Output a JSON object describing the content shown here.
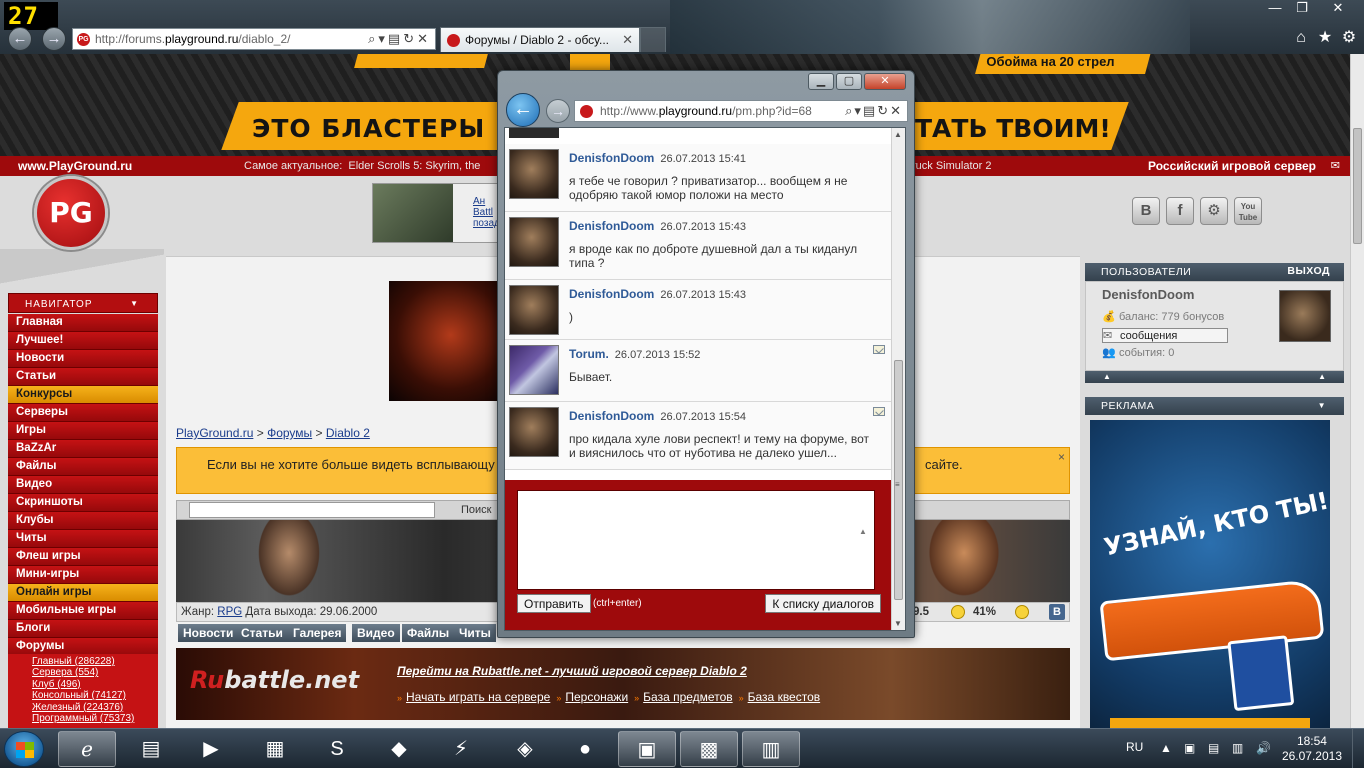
{
  "overlay": {
    "fps": "27"
  },
  "browser": {
    "url_prefix": "http://forums.",
    "url_domain": "playground.ru",
    "url_suffix": "/diablo_2/",
    "tab_title": "Форумы / Diablo 2 - обсу..."
  },
  "banner": {
    "headline_left": "ЭТО БЛАСТЕРЫ N",
    "headline_right": "ТАТЬ ТВОИМ!",
    "top_ad": "Обойма на 20 стрел"
  },
  "redbar": {
    "site": "www.PlayGround.ru",
    "hot_label": "Самое актуальное:",
    "hot_item": "Elder Scrolls 5: Skyrim, the",
    "hot_item2": "ruck Simulator 2",
    "server": "Российский игровой сервер"
  },
  "logo": {
    "text": "PG"
  },
  "adbox": {
    "text": "Ан\nBattl\nпозад"
  },
  "social": [
    {
      "name": "vk",
      "label": "B"
    },
    {
      "name": "facebook",
      "label": "f"
    },
    {
      "name": "steam",
      "label": "⚙"
    },
    {
      "name": "youtube",
      "label": "You\nTube"
    }
  ],
  "nav": {
    "header": "НАВИГАТОР",
    "items": [
      {
        "label": "Главная",
        "highlight": false
      },
      {
        "label": "Лучшее!",
        "highlight": false
      },
      {
        "label": "Новости",
        "highlight": false
      },
      {
        "label": "Статьи",
        "highlight": false
      },
      {
        "label": "Конкурсы",
        "highlight": true
      },
      {
        "label": "Серверы",
        "highlight": false
      },
      {
        "label": "Игры",
        "highlight": false
      },
      {
        "label": "BaZzAr",
        "highlight": false
      },
      {
        "label": "Файлы",
        "highlight": false
      },
      {
        "label": "Видео",
        "highlight": false
      },
      {
        "label": "Скриншоты",
        "highlight": false
      },
      {
        "label": "Клубы",
        "highlight": false
      },
      {
        "label": "Читы",
        "highlight": false
      },
      {
        "label": "Флеш игры",
        "highlight": false
      },
      {
        "label": "Мини-игры",
        "highlight": false
      },
      {
        "label": "Онлайн игры",
        "highlight": true
      },
      {
        "label": "Мобильные игры",
        "highlight": false
      },
      {
        "label": "Блоги",
        "highlight": false
      },
      {
        "label": "Форумы",
        "highlight": false
      }
    ],
    "subforums": [
      "Главный (286228)",
      "Сервера (554)",
      "Клуб (496)",
      "Консольный (74127)",
      "Железный (224376)",
      "Программный (75373)"
    ]
  },
  "breadcrumb": {
    "home": "PlayGround.ru",
    "sep": ">",
    "forums": "Форумы",
    "game": "Diablo 2"
  },
  "notice": {
    "text": "Если вы не хотите больше видеть всплывающу",
    "text_end": "сайте.",
    "close": "×"
  },
  "gamebar": {
    "search_label": "Поиск"
  },
  "gameinfo": {
    "genre_label": "Жанр:",
    "genre": "RPG",
    "release_label": "Дата выхода:",
    "release": "29.06.2000",
    "rating": "9.5",
    "percent": "41%"
  },
  "gametabs": [
    "Новости",
    "Статьи",
    "Галерея",
    "Видео",
    "Файлы",
    "Читы"
  ],
  "rubattle": {
    "logo_r": "Ru",
    "logo_rest": "battle.net",
    "title": "Перейти на Rubattle.net - лучший игровой сервер Diablo 2",
    "links": [
      "Начать играть на сервере",
      "Персонажи",
      "База предметов",
      "База квестов"
    ]
  },
  "users": {
    "header": "ПОЛЬЗОВАТЕЛИ",
    "logout": "ВЫХОД",
    "name": "DenisfonDoom",
    "balance": "баланс: 779 бонусов",
    "messages": "сообщения",
    "events": "события: 0"
  },
  "ads": {
    "header": "РЕКЛАМА",
    "slogan": "УЗНАЙ, КТО ТЫ!"
  },
  "popup": {
    "url_prefix": "http://www.",
    "url_domain": "playground.ru",
    "url_suffix": "/pm.php?id=68",
    "messages": [
      {
        "author": "DenisfonDoom",
        "time": "26.07.2013 15:41",
        "text": "я тебе че говорил ? приватизатор... вообщем я не одобряю такой юмор положи на место",
        "avatar": "dd",
        "read": false
      },
      {
        "author": "DenisfonDoom",
        "time": "26.07.2013 15:43",
        "text": "я вроде как по доброте душевной дал а ты киданул типа ?",
        "avatar": "dd",
        "read": false
      },
      {
        "author": "DenisfonDoom",
        "time": "26.07.2013 15:43",
        "text": ")",
        "avatar": "dd",
        "read": false
      },
      {
        "author": "Torum.",
        "time": "26.07.2013 15:52",
        "text": "Бывает.",
        "avatar": "tr",
        "read": true
      },
      {
        "author": "DenisfonDoom",
        "time": "26.07.2013 15:54",
        "text": "про кидала хуле лови респект! и тему на форуме, вот и вияснилось что от нуботива не далеко ушел...",
        "avatar": "dd",
        "read": true
      }
    ],
    "send_label": "Отправить",
    "send_hint": "(ctrl+enter)",
    "list_label": "К списку диалогов"
  },
  "taskbar": {
    "lang": "RU",
    "time": "18:54",
    "date": "26.07.2013"
  }
}
